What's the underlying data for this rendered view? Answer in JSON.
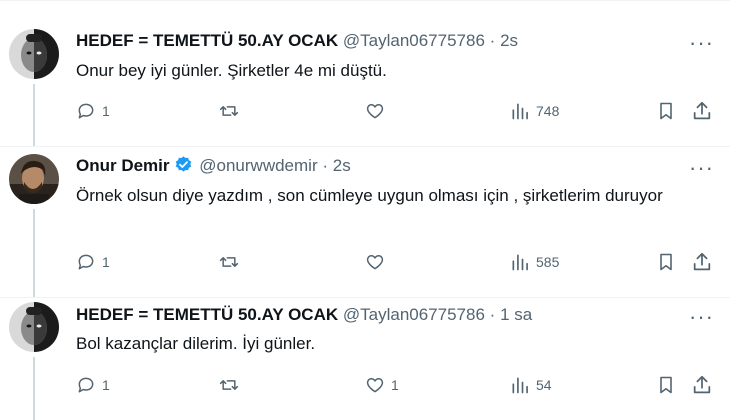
{
  "tweets": [
    {
      "name": "HEDEF = TEMETTÜ 50.AY OCAK",
      "handle": "@Taylan06775786",
      "separator": "·",
      "time": "2s",
      "verified": false,
      "text": "Onur bey iyi günler. Şirketler 4e mi düştü.",
      "more": "···",
      "replies": "1",
      "retweets": "",
      "likes": "",
      "views": "748"
    },
    {
      "name": "Onur Demir",
      "handle": "@onurwwdemir",
      "separator": "·",
      "time": "2s",
      "verified": true,
      "text": "Örnek olsun diye yazdım , son cümleye uygun olması için , şirketlerim duruyor",
      "more": "···",
      "replies": "1",
      "retweets": "",
      "likes": "",
      "views": "585"
    },
    {
      "name": "HEDEF = TEMETTÜ 50.AY OCAK",
      "handle": "@Taylan06775786",
      "separator": "·",
      "time": "1 sa",
      "verified": false,
      "text": "Bol kazançlar dilerim. İyi günler.",
      "more": "···",
      "replies": "1",
      "retweets": "",
      "likes": "1",
      "views": "54"
    }
  ],
  "colors": {
    "verified": "#1d9bf0",
    "secondary_text": "#536471",
    "divider": "#eff3f4"
  }
}
